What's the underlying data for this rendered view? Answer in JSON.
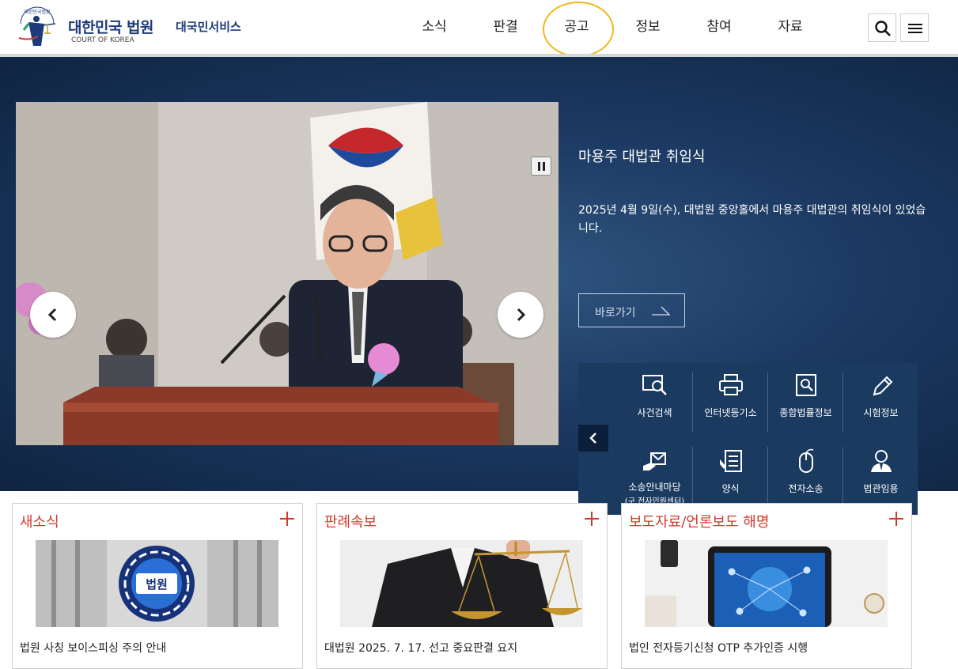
{
  "header": {
    "logo_title": "대한민국 법원",
    "logo_subtitle": "COURT OF KOREA",
    "emblem_text": "대한민국법원",
    "service_name": "대국민서비스",
    "nav": [
      {
        "label": "소식"
      },
      {
        "label": "판결"
      },
      {
        "label": "공고"
      },
      {
        "label": "정보"
      },
      {
        "label": "참여"
      },
      {
        "label": "자료"
      }
    ],
    "search_icon": "search-icon",
    "menu_icon": "hamburger-menu-icon"
  },
  "hero": {
    "title": "마용주 대법관 취임식",
    "description": "2025년 4월 9일(수), 대법원 중앙홀에서 마용주 대법관의 취임식이 있었습니다.",
    "goto_label": "바로가기",
    "quick_links": [
      {
        "label": "사건검색",
        "icon": "case-search-icon"
      },
      {
        "label": "인터넷등기소",
        "icon": "printer-icon"
      },
      {
        "label": "종합법률정보",
        "icon": "legal-info-icon"
      },
      {
        "label": "시험정보",
        "icon": "pen-icon"
      },
      {
        "label": "소송안내마당",
        "sublabel": "(구 전자민원센터)",
        "icon": "envelope-hand-icon"
      },
      {
        "label": "양식",
        "icon": "form-icon"
      },
      {
        "label": "전자소송",
        "icon": "mouse-icon"
      },
      {
        "label": "법관임용",
        "icon": "judge-icon"
      }
    ]
  },
  "cards": [
    {
      "title": "새소식",
      "caption": "법원 사칭 보이스피싱 주의 안내",
      "badge": "법원"
    },
    {
      "title": "판례속보",
      "caption": "대법원 2025. 7. 17. 선고 중요판결 요지"
    },
    {
      "title": "보도자료/언론보도 해명",
      "caption": "법인 전자등기신청 OTP 추가인증 시행"
    }
  ],
  "colors": {
    "brand_navy": "#1d3b7a",
    "accent_red": "#d33a2c",
    "highlight_ring": "#f0b81a",
    "hero_bg": "#1c3a63"
  }
}
